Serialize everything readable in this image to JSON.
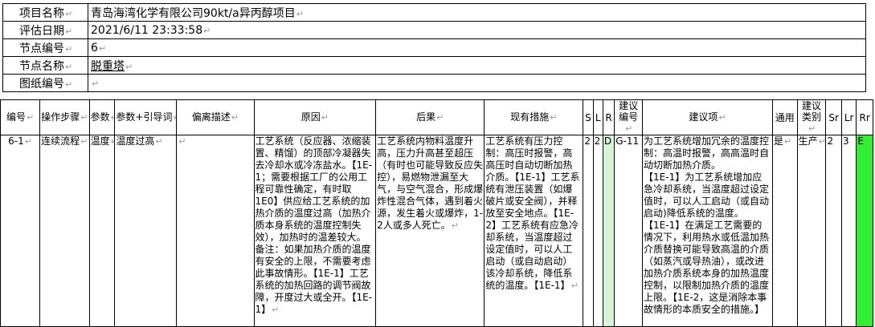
{
  "header": {
    "rows": [
      {
        "label": "项目名称",
        "value": "青岛海湾化学有限公司90kt/a异丙醇项目"
      },
      {
        "label": "评估日期",
        "value": "2021/6/11 23:33:58"
      },
      {
        "label": "节点编号",
        "value": "6"
      },
      {
        "label": "节点名称",
        "value": "脱重塔"
      },
      {
        "label": "图纸编号",
        "value": ""
      }
    ]
  },
  "table": {
    "columns": [
      "编号",
      "操作步骤",
      "参数",
      "参数+引导词",
      "偏离描述",
      "原因",
      "后果",
      "现有措施",
      "S",
      "L",
      "R",
      "建议编号",
      "建议项",
      "通用",
      "建议类别",
      "Sr",
      "Lr",
      "Rr"
    ],
    "row": {
      "id": "6-1",
      "step": "连续流程",
      "param": "温度",
      "param_guide": "温度过高",
      "deviation": "",
      "cause": [
        "工艺系统（反应器、浓缩装置、精馏）的顶部冷凝器失去冷却水或冷冻盐水。【1E-1；需要根据工厂的公用工程可靠性确定，有时取1E0】供应给工艺系统的加热介质的温度过高（加热介质本身系统的温度控制失效），加热时的温差较大。备注：如果加热介质的温度有安全的上限，不需要考虑此事故情形。【1E-1】工艺系统的加热回路的调节阀故障，开度过大或全开。【1E-1】"
      ],
      "consequence": "工艺系统内物料温度升高，压力升高甚至超压（有时也可能导致反应失控），易燃物泄漏至大气，与空气混合，形成爆炸性混合气体，遇到着火源，发生着火或爆炸，1-2人或多人死亡。",
      "measures": [
        "工艺系统有压力控制：高压时报警，高高压时自动切断加热介质。【1E-1】工艺系统有泄压装置（如爆破片或安全阀），并释放至安全地点。",
        "【1E-2】工艺系统有应急冷却系统，当温度超过设定值时，可以人工启动（或自动启动）该冷却系统，降低系统的温度。【1E-1】"
      ],
      "S": "2",
      "L": "2",
      "R": "D",
      "rec_id": "G-11",
      "recommendations": [
        "为工艺系统增加冗余的温度控制：高温时报警，高高温时自动切断加热介质。",
        "【1E-1】为工艺系统增加应急冷却系统，当温度超过设定值时，可以人工启动（或自动启动)降低系统的温度。",
        "【1E-1】在满足工艺需要的情况下，利用热水或低温加热介质替换可能导致高温的介质（如蒸汽或导热油），或改进加热介质系统本身的加热温度控制，以限制加热介质的温度上限。【1E-2，这是消除本事故情形的本质安全的措施。】"
      ],
      "general": "是",
      "category": "生产",
      "Sr": "2",
      "Lr": "3",
      "Rr": "E"
    }
  },
  "colors": {
    "rr_fill": "#33ee33",
    "r_fill": "#d6f5d6",
    "border": "#000000"
  }
}
